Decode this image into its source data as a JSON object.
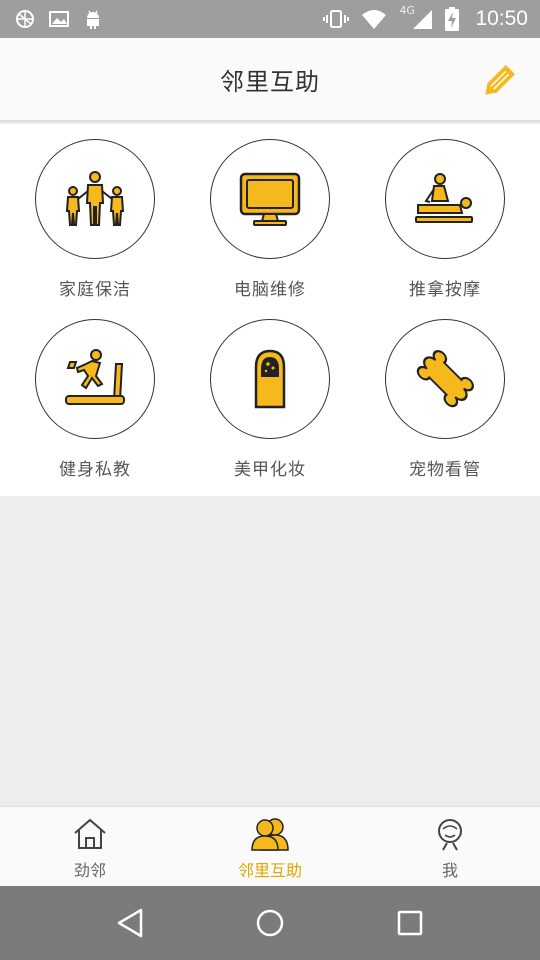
{
  "status_bar": {
    "time": "10:50",
    "network_label": "4G",
    "icons": [
      "gallery-icon",
      "image-icon",
      "android-icon",
      "vibrate-icon",
      "wifi-icon",
      "signal-icon",
      "battery-charging-icon"
    ]
  },
  "header": {
    "title": "邻里互助",
    "edit_icon": "pencil-icon"
  },
  "services": [
    {
      "label": "家庭保洁",
      "icon": "family-icon"
    },
    {
      "label": "电脑维修",
      "icon": "monitor-icon"
    },
    {
      "label": "推拿按摩",
      "icon": "massage-icon"
    },
    {
      "label": "健身私教",
      "icon": "treadmill-icon"
    },
    {
      "label": "美甲化妆",
      "icon": "nail-icon"
    },
    {
      "label": "宠物看管",
      "icon": "bone-icon"
    }
  ],
  "tabs": [
    {
      "label": "劲邻",
      "icon": "house-icon",
      "active": false
    },
    {
      "label": "邻里互助",
      "icon": "people-icon",
      "active": true
    },
    {
      "label": "我",
      "icon": "person-icon",
      "active": false
    }
  ],
  "colors": {
    "accent": "#f5b81d",
    "active_tab": "#e0a800",
    "status_bar": "#9e9e9e",
    "nav_bar": "#7b7b7b"
  }
}
